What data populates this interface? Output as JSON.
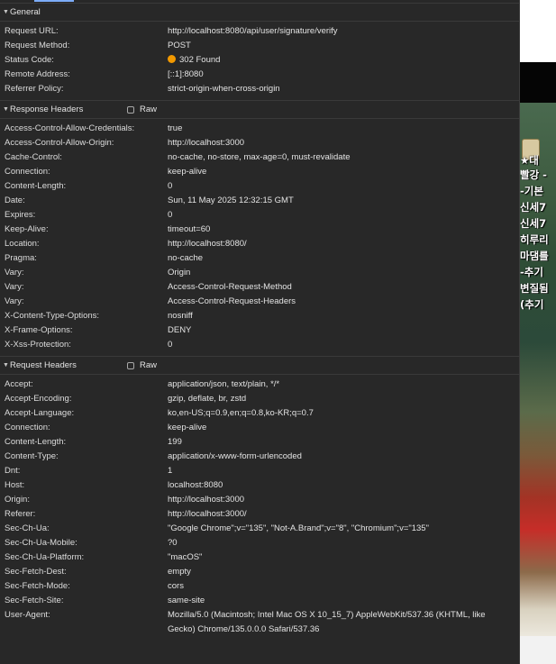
{
  "general": {
    "title": "General",
    "rows": [
      {
        "key": "Request URL:",
        "value": "http://localhost:8080/api/user/signature/verify"
      },
      {
        "key": "Request Method:",
        "value": "POST"
      },
      {
        "key": "Status Code:",
        "value": "302 Found",
        "status_color": "#f29900"
      },
      {
        "key": "Remote Address:",
        "value": "[::1]:8080"
      },
      {
        "key": "Referrer Policy:",
        "value": "strict-origin-when-cross-origin"
      }
    ]
  },
  "response_headers": {
    "title": "Response Headers",
    "raw_label": "Raw",
    "rows": [
      {
        "key": "Access-Control-Allow-Credentials:",
        "value": "true"
      },
      {
        "key": "Access-Control-Allow-Origin:",
        "value": "http://localhost:3000"
      },
      {
        "key": "Cache-Control:",
        "value": "no-cache, no-store, max-age=0, must-revalidate"
      },
      {
        "key": "Connection:",
        "value": "keep-alive"
      },
      {
        "key": "Content-Length:",
        "value": "0"
      },
      {
        "key": "Date:",
        "value": "Sun, 11 May 2025 12:32:15 GMT"
      },
      {
        "key": "Expires:",
        "value": "0"
      },
      {
        "key": "Keep-Alive:",
        "value": "timeout=60"
      },
      {
        "key": "Location:",
        "value": "http://localhost:8080/"
      },
      {
        "key": "Pragma:",
        "value": "no-cache"
      },
      {
        "key": "Vary:",
        "value": "Origin"
      },
      {
        "key": "Vary:",
        "value": "Access-Control-Request-Method"
      },
      {
        "key": "Vary:",
        "value": "Access-Control-Request-Headers"
      },
      {
        "key": "X-Content-Type-Options:",
        "value": "nosniff"
      },
      {
        "key": "X-Frame-Options:",
        "value": "DENY"
      },
      {
        "key": "X-Xss-Protection:",
        "value": "0"
      }
    ]
  },
  "request_headers": {
    "title": "Request Headers",
    "raw_label": "Raw",
    "rows": [
      {
        "key": "Accept:",
        "value": "application/json, text/plain, */*"
      },
      {
        "key": "Accept-Encoding:",
        "value": "gzip, deflate, br, zstd"
      },
      {
        "key": "Accept-Language:",
        "value": "ko,en-US;q=0.9,en;q=0.8,ko-KR;q=0.7"
      },
      {
        "key": "Connection:",
        "value": "keep-alive"
      },
      {
        "key": "Content-Length:",
        "value": "199"
      },
      {
        "key": "Content-Type:",
        "value": "application/x-www-form-urlencoded"
      },
      {
        "key": "Dnt:",
        "value": "1"
      },
      {
        "key": "Host:",
        "value": "localhost:8080"
      },
      {
        "key": "Origin:",
        "value": "http://localhost:3000"
      },
      {
        "key": "Referer:",
        "value": "http://localhost:3000/"
      },
      {
        "key": "Sec-Ch-Ua:",
        "value": "\"Google Chrome\";v=\"135\", \"Not-A.Brand\";v=\"8\", \"Chromium\";v=\"135\""
      },
      {
        "key": "Sec-Ch-Ua-Mobile:",
        "value": "?0"
      },
      {
        "key": "Sec-Ch-Ua-Platform:",
        "value": "\"macOS\""
      },
      {
        "key": "Sec-Fetch-Dest:",
        "value": "empty"
      },
      {
        "key": "Sec-Fetch-Mode:",
        "value": "cors"
      },
      {
        "key": "Sec-Fetch-Site:",
        "value": "same-site"
      },
      {
        "key": "User-Agent:",
        "value": "Mozilla/5.0 (Macintosh; Intel Mac OS X 10_15_7) AppleWebKit/537.36 (KHTML, like Gecko) Chrome/135.0.0.0 Safari/537.36"
      }
    ]
  },
  "page_preview": {
    "lines": [
      "★대",
      "빨강 -",
      "-기본",
      "신세7",
      "신세7",
      "히루리",
      "마댐를",
      "-추기",
      "변질됨",
      "(추기"
    ]
  }
}
